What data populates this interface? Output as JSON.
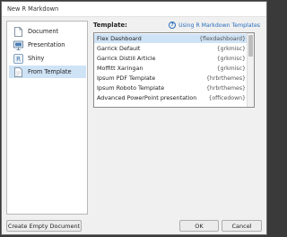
{
  "window": {
    "title": "New R Markdown"
  },
  "sidebar": {
    "items": [
      {
        "label": "Document",
        "icon": "document-icon"
      },
      {
        "label": "Presentation",
        "icon": "presentation-icon"
      },
      {
        "label": "Shiny",
        "icon": "shiny-icon"
      },
      {
        "label": "From Template",
        "icon": "template-icon",
        "selected": true
      }
    ]
  },
  "main": {
    "template_label": "Template:",
    "help_link": "Using R Markdown Templates",
    "templates": [
      {
        "name": "Flex Dashboard",
        "package": "{flexdashboard}",
        "selected": true
      },
      {
        "name": "Garrick Default",
        "package": "{grkmisc}"
      },
      {
        "name": "Garrick Distill Article",
        "package": "{grkmisc}"
      },
      {
        "name": "Moffitt Xaringan",
        "package": "{grkmisc}"
      },
      {
        "name": "Ipsum PDF Template",
        "package": "{hrbrthemes}"
      },
      {
        "name": "Ipsum Roboto Template",
        "package": "{hrbrthemes}"
      },
      {
        "name": "Advanced PowerPoint presentation",
        "package": "{officedown}"
      }
    ]
  },
  "buttons": {
    "create_empty": "Create Empty Document",
    "ok": "OK",
    "cancel": "Cancel"
  },
  "colors": {
    "selection": "#cfe3f6",
    "link": "#2a6ebd"
  }
}
